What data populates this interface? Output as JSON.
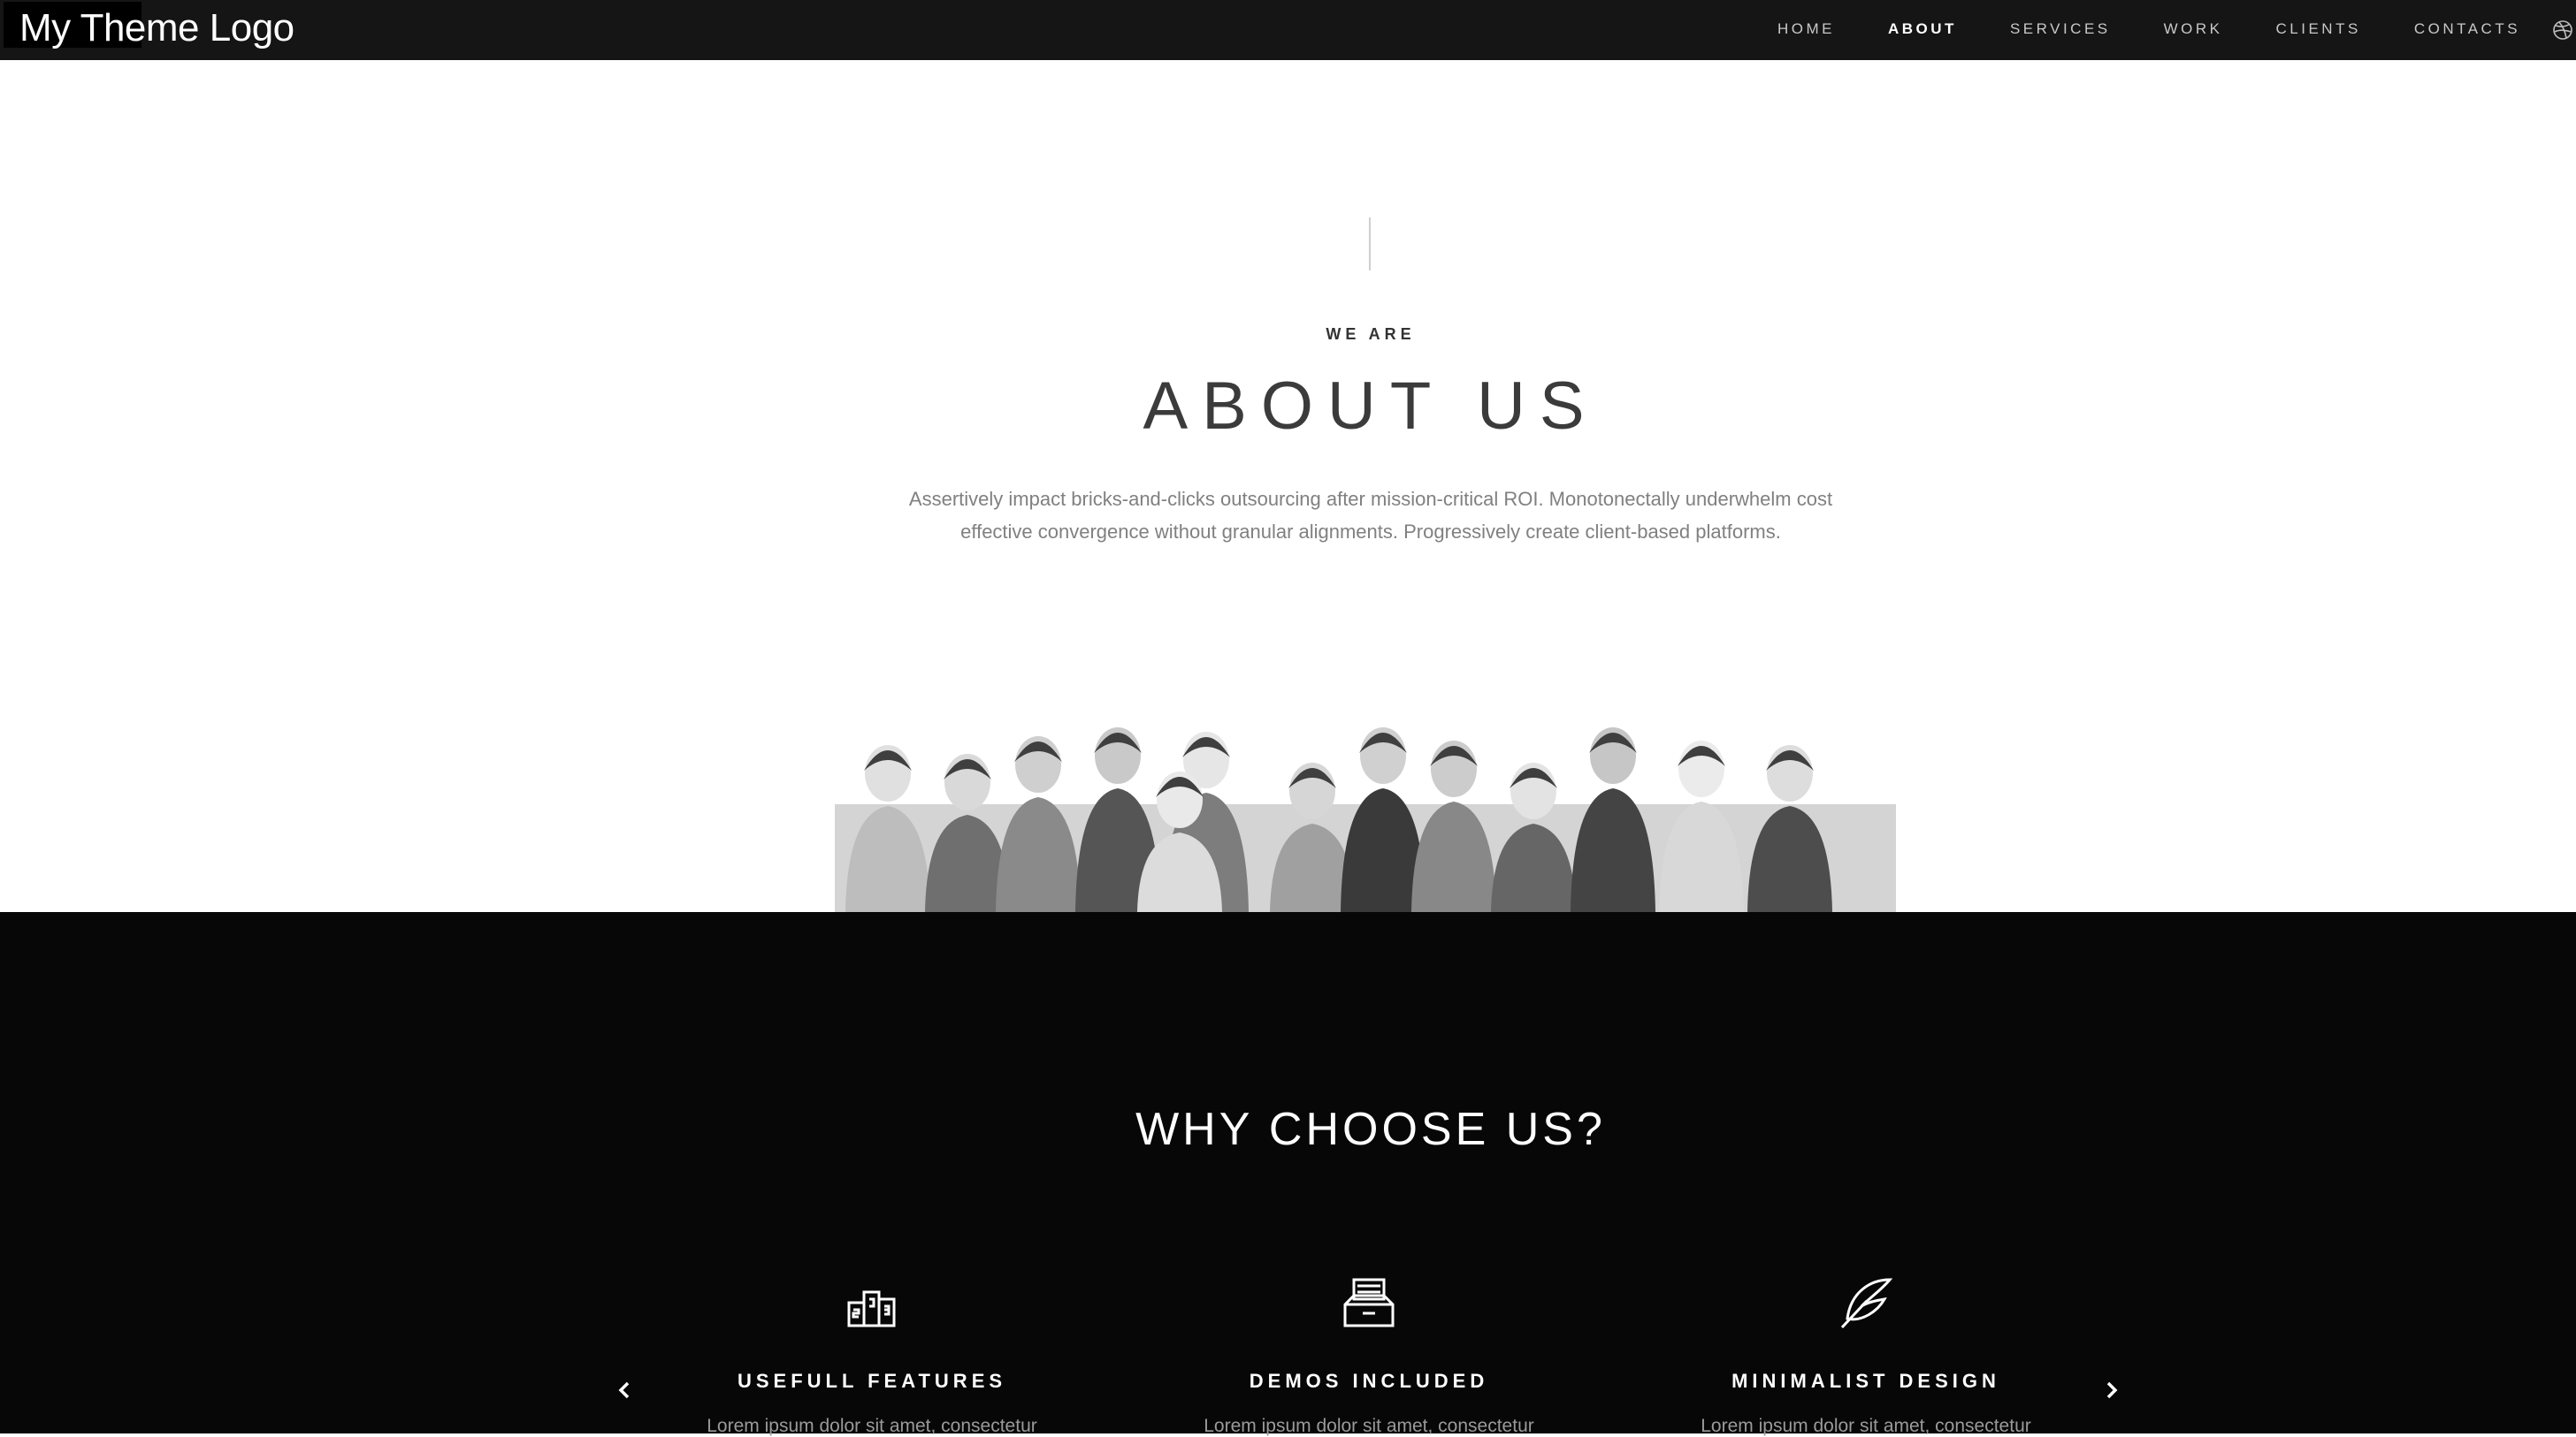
{
  "nav": {
    "logo": "My Theme Logo",
    "items": [
      {
        "label": "HOME"
      },
      {
        "label": "ABOUT"
      },
      {
        "label": "SERVICES"
      },
      {
        "label": "WORK"
      },
      {
        "label": "CLIENTS"
      },
      {
        "label": "CONTACTS"
      }
    ],
    "active": "ABOUT",
    "social_icon": "dribbble-icon"
  },
  "about": {
    "eyebrow": "WE ARE",
    "title": "ABOUT US",
    "text": "Assertively impact bricks-and-clicks outsourcing after mission-critical ROI. Monotonectally underwhelm cost effective convergence without granular alignments. Progressively create client-based platforms.",
    "image": "group-of-people-photo"
  },
  "why": {
    "title": "WHY CHOOSE US?",
    "features": [
      {
        "icon": "podium-icon",
        "title": "USEFULL FEATURES",
        "text": "Lorem ipsum dolor sit amet, consectetur"
      },
      {
        "icon": "inbox-tray-icon",
        "title": "DEMOS INCLUDED",
        "text": "Lorem ipsum dolor sit amet, consectetur"
      },
      {
        "icon": "feather-icon",
        "title": "MINIMALIST DESIGN",
        "text": "Lorem ipsum dolor sit amet, consectetur"
      }
    ],
    "prev_icon": "chevron-left-icon",
    "next_icon": "chevron-right-icon"
  },
  "colors": {
    "nav_bg": "#151515",
    "dark_bg": "#070707",
    "text_gray": "#808080"
  }
}
